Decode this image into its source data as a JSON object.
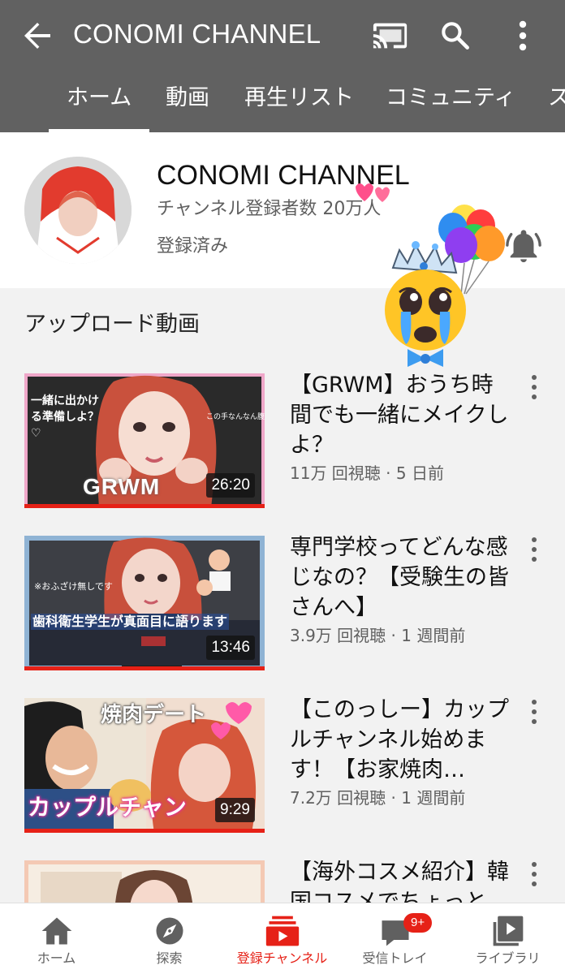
{
  "appbar": {
    "title": "CONOMI CHANNEL"
  },
  "tabs": [
    "ホーム",
    "動画",
    "再生リスト",
    "コミュニティ",
    "ス"
  ],
  "channel": {
    "name": "CONOMI CHANNEL",
    "subscribers": "チャンネル登録者数 20万人",
    "subscribed_label": "登録済み"
  },
  "section_title": "アップロード動画",
  "videos": [
    {
      "title": "【GRWM】おうち時間でも一緒にメイクしよ？",
      "meta": "11万 回視聴 · 5 日前",
      "duration": "26:20",
      "thumb_caption": "一緒に出かける準備しよ？♡",
      "thumb_caption2": "この手なんなん腹立つ",
      "thumb_big": "GRWM"
    },
    {
      "title": "専門学校ってどんな感じなの？【受験生の皆さんへ】",
      "meta": "3.9万 回視聴 · 1 週間前",
      "duration": "13:46",
      "thumb_caption": "※おふざけ無しです",
      "thumb_big": "歯科衛生学生が真面目に語ります"
    },
    {
      "title": "【このっしー】カップルチャンネル始めます！【お家焼肉…",
      "meta": "7.2万 回視聴 · 1 週間前",
      "duration": "9:29",
      "thumb_caption": "焼肉デート",
      "thumb_big": "カップルチャン"
    },
    {
      "title": "【海外コスメ紹介】韓国コスメでちょっと",
      "meta": "",
      "duration": "",
      "thumb_caption": "",
      "thumb_big": ""
    }
  ],
  "bottom_nav": [
    {
      "label": "ホーム",
      "icon": "home-icon"
    },
    {
      "label": "探索",
      "icon": "explore-icon"
    },
    {
      "label": "登録チャンネル",
      "icon": "subscriptions-icon"
    },
    {
      "label": "受信トレイ",
      "icon": "inbox-icon",
      "badge": "9+"
    },
    {
      "label": "ライブラリ",
      "icon": "library-icon"
    }
  ],
  "colors": {
    "appbar": "#616161",
    "accent": "#e62117",
    "feed_bg": "#f2f2f2"
  }
}
